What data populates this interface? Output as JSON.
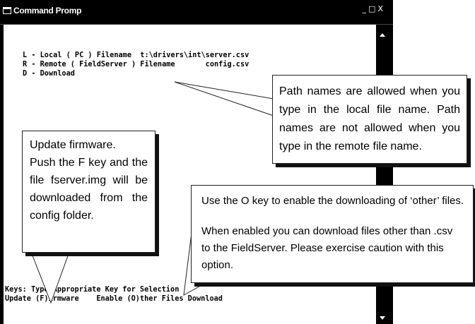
{
  "window": {
    "title": "Command Promp",
    "controls": {
      "minimize": "_",
      "maximize": "□",
      "close": "X"
    }
  },
  "console": {
    "menu_lines": [
      "L - Local ( PC ) Filename  t:\\drivers\\int\\server.csv",
      "R - Remote ( FieldServer ) Filename       config.csv",
      "D - Download"
    ],
    "keys_line": "Keys: Type Appropriate Key for Selection",
    "options_line": "Update (F)irmware    Enable (O)ther Files Download"
  },
  "callouts": {
    "path_names": "Path names are allowed when you type in the local file name.  Path names are not allowed when you type in the remote file name.",
    "firmware": {
      "line1": "Update firmware.",
      "line2": "Push the F key and the file fserver.img will be downloaded from the config folder."
    },
    "other_files": {
      "line1": "Use the O key to enable the downloading of ‘other’ files.",
      "line2": "When enabled you can download files other than .csv to the FieldServer. Please exercise caution with this option."
    }
  }
}
